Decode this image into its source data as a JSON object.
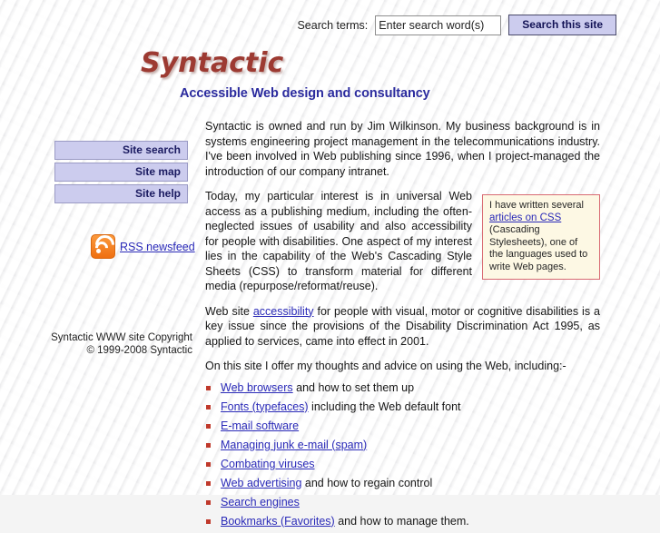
{
  "search": {
    "label": "Search terms:",
    "placeholder": "Enter search word(s)",
    "value": "Enter search word(s)",
    "button_label": "Search this site"
  },
  "masthead": {
    "logo": "Syntactic",
    "tagline": "Accessible Web design and consultancy",
    "logo_color": "#9d3a32",
    "tagline_color": "#2b2b9e"
  },
  "sidebar": {
    "items": [
      {
        "label": "Site search"
      },
      {
        "label": "Site map"
      },
      {
        "label": "Site help"
      }
    ],
    "rss": {
      "icon": "rss-icon",
      "label": "RSS newsfeed"
    },
    "copyright_line1": "Syntactic WWW site Copyright",
    "copyright_line2": "© 1999-2008 Syntactic"
  },
  "main": {
    "para1": "Syntactic is owned and run by Jim Wilkinson. My business background is in systems engineering project management in the telecommunications industry. I've been involved in Web publishing since 1996, when I project-managed the introduction of our company intranet.",
    "para2_a": "Today, my particular interest is in universal Web access as a publishing medium, including the often-neglected issues of usability and also accessibility for people with disabilities. One aspect of my interest lies in the capability of the Web's Cascading Style Sheets (CSS) to transform material for different media (repurpose/reformat/reuse).",
    "para3_before": "Web site ",
    "para3_link": "accessibility",
    "para3_after": " for people with visual, motor or cognitive disabilities is a key issue since the provisions of the Disability Discrimination Act 1995, as applied to services, came into effect in 2001.",
    "para4": "On this site I offer my thoughts and advice on using the Web, including:-",
    "pullquote": {
      "before": "I have written several ",
      "link": "articles on CSS",
      "after": " (Cascading Stylesheets), one of the languages used to write Web pages.",
      "border_color": "#d86a72",
      "bg_color": "#fdf8e4"
    },
    "topics": [
      {
        "link": "Web browsers",
        "after": " and how to set them up"
      },
      {
        "link": "Fonts (typefaces)",
        "after": " including the Web default font"
      },
      {
        "link": "E-mail software",
        "after": ""
      },
      {
        "link": "Managing junk e-mail (spam)",
        "after": ""
      },
      {
        "link": "Combating viruses",
        "after": ""
      },
      {
        "link": "Web advertising",
        "after": " and how to regain control"
      },
      {
        "link": "Search engines",
        "after": ""
      },
      {
        "link": "Bookmarks (Favorites)",
        "after": " and how to manage them."
      }
    ],
    "bullet_color": "#c0392b",
    "link_color": "#2a2ab8"
  }
}
